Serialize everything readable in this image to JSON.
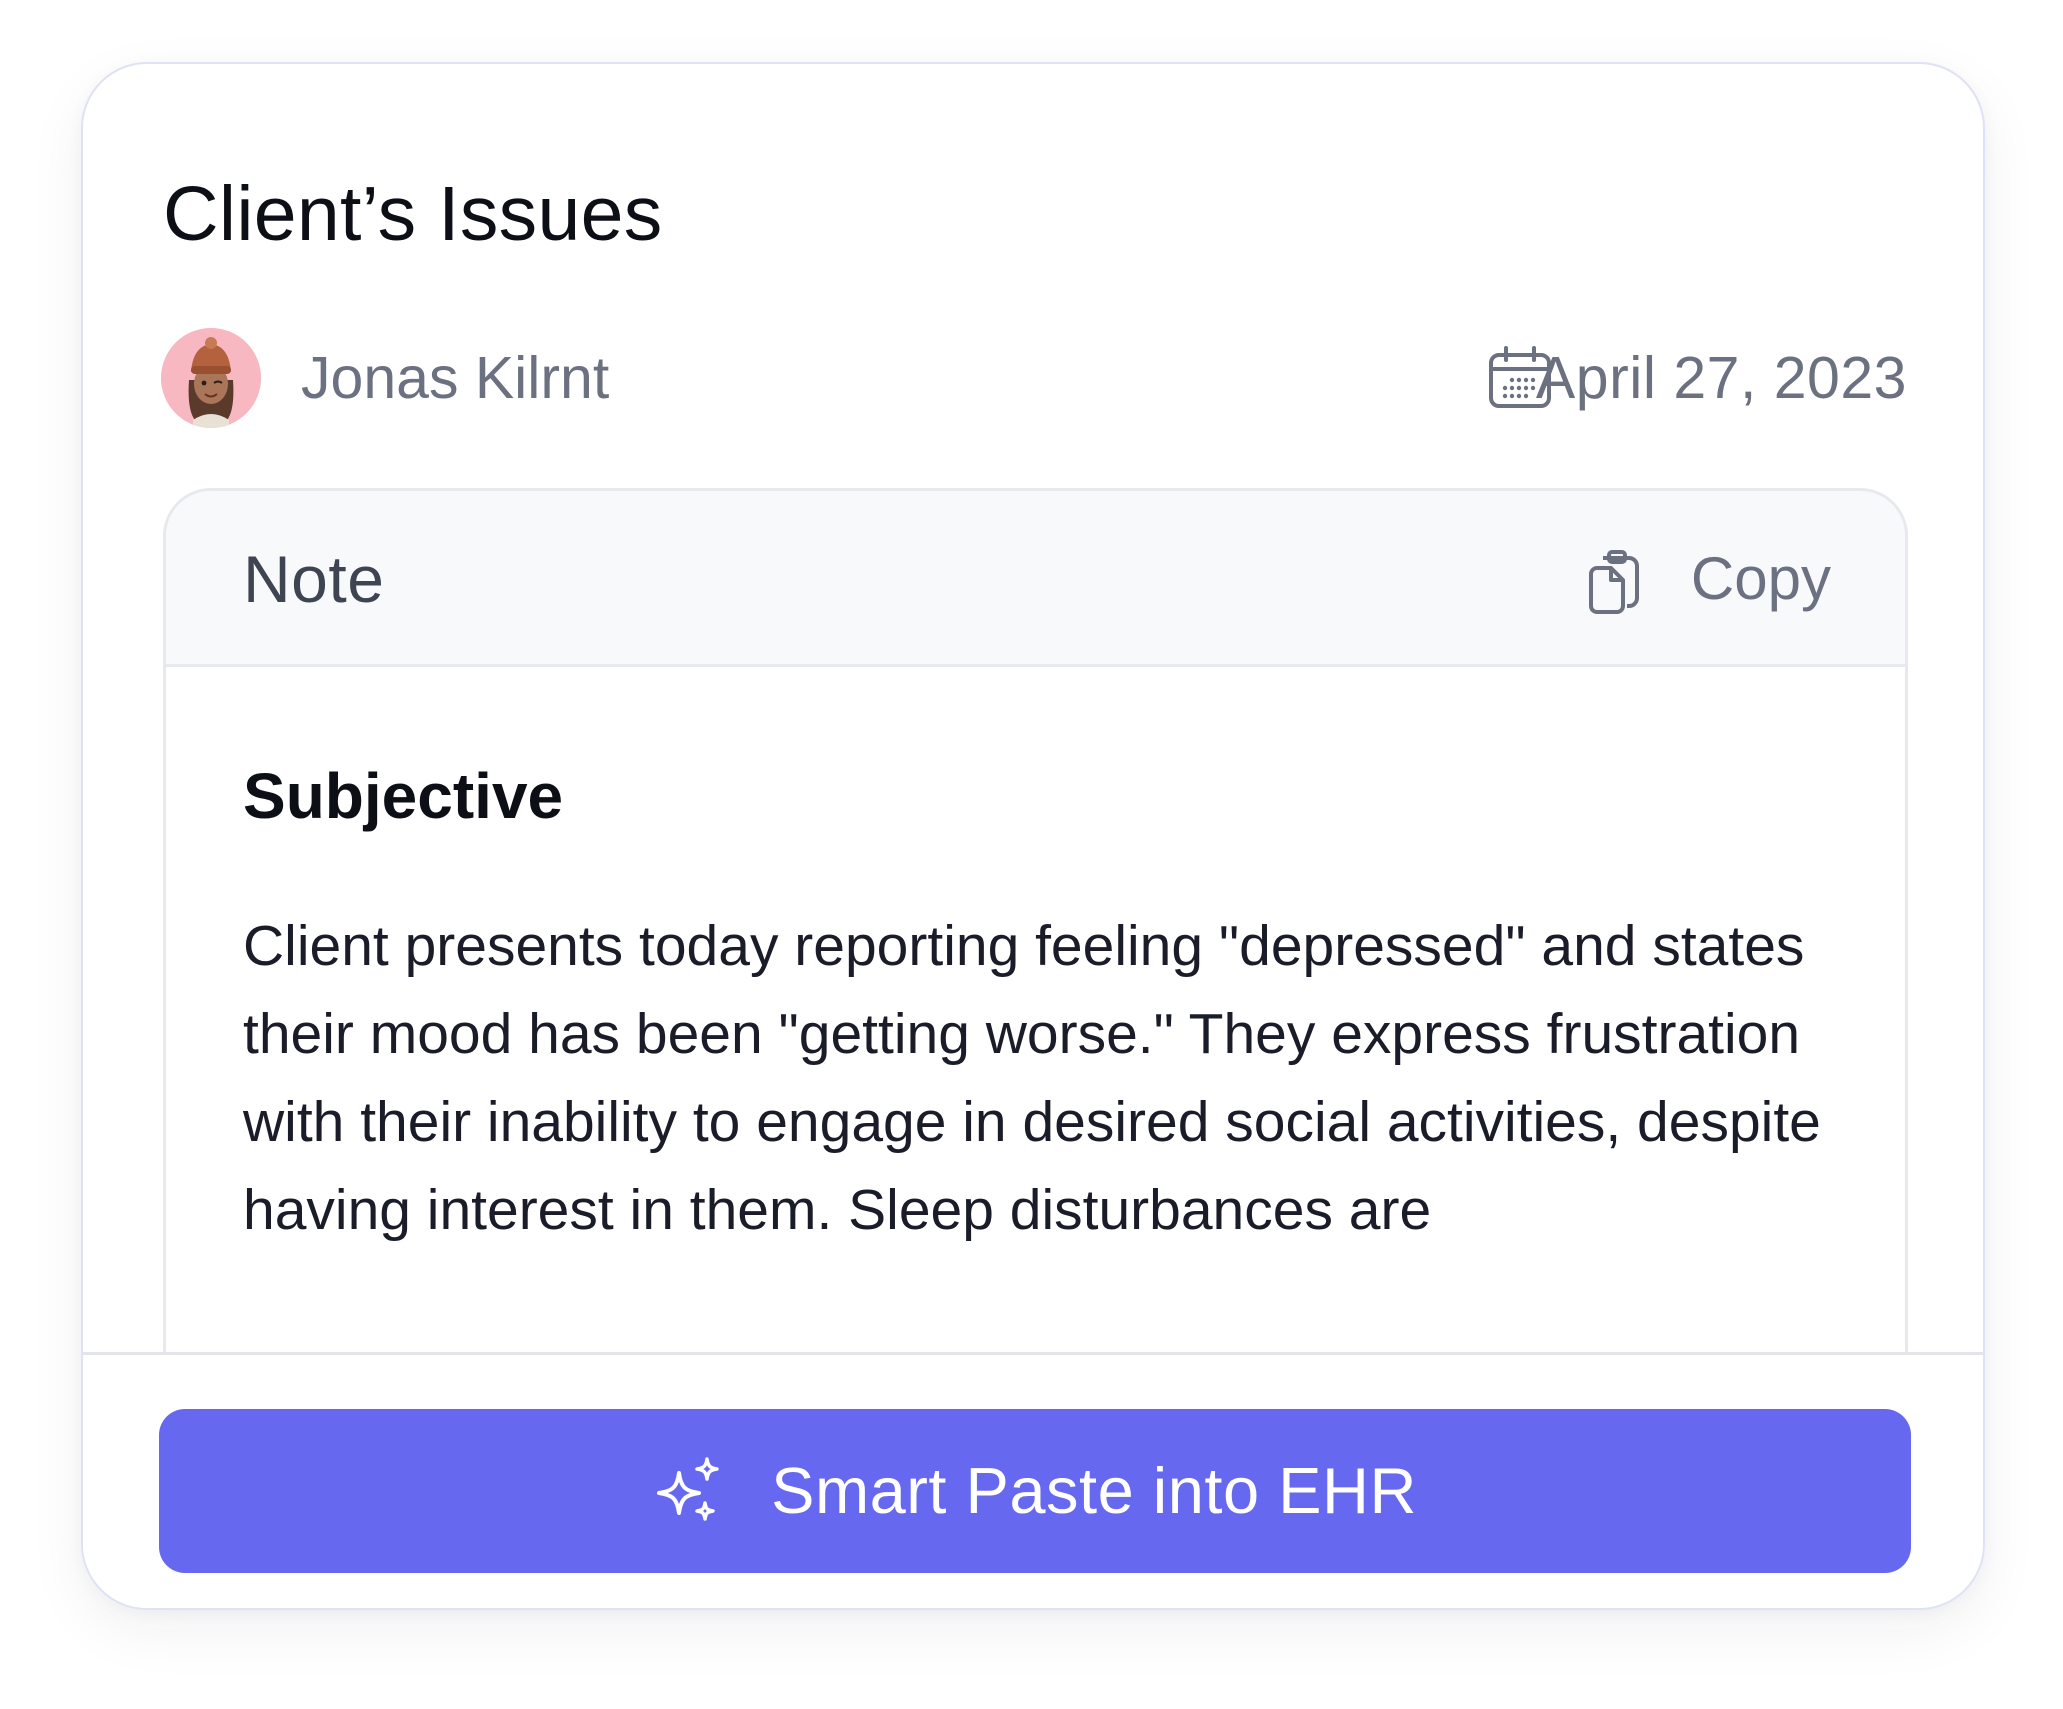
{
  "card": {
    "title": "Client’s Issues"
  },
  "meta": {
    "author_name": "Jonas Kilrnt",
    "date": "April 27, 2023",
    "avatar_icon": "memoji-avatar",
    "calendar_icon": "calendar-icon"
  },
  "note": {
    "header_label": "Note",
    "copy_label": "Copy",
    "copy_icon": "clipboard-copy-icon",
    "section": {
      "heading": "Subjective",
      "body": "Client presents today reporting feeling \"depressed\" and states their mood has been \"getting worse.\" They express frustration with their inability to engage in desired social activities, despite having interest in them. Sleep disturbances are"
    }
  },
  "actions": {
    "smart_paste_label": "Smart Paste into EHR",
    "smart_paste_icon": "sparkles-icon"
  },
  "colors": {
    "accent": "#6668f0",
    "muted_text": "#6b7180",
    "body_text": "#1a1d29",
    "avatar_bg": "#f7b8c2",
    "card_border": "#dfe2f5"
  }
}
